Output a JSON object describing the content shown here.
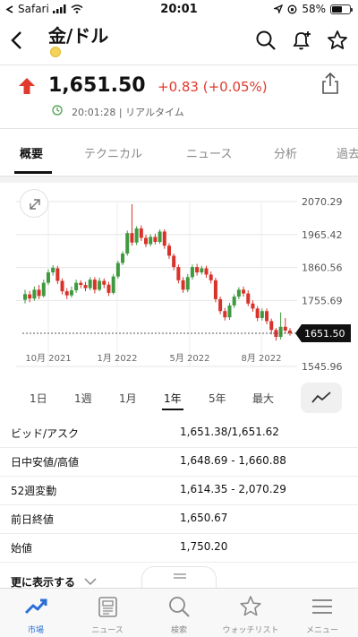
{
  "status_bar": {
    "carrier": "Safari",
    "time": "20:01",
    "battery": "58%",
    "battery_level": 0.58
  },
  "header": {
    "title": "金/ドル"
  },
  "quote": {
    "price": "1,651.50",
    "change": "+0.83 (+0.05%)",
    "time": "20:01:28 | リアルタイム",
    "up_color": "#e03a2e"
  },
  "tabs": [
    "概要",
    "テクニカル",
    "ニュース",
    "分析",
    "過去"
  ],
  "chart": {
    "current_label": "1,651.50"
  },
  "chart_data": {
    "type": "candlestick",
    "x_tick_labels": [
      "10月 2021",
      "1月 2022",
      "5月 2022",
      "8月 2022"
    ],
    "y_tick_labels": [
      "2070.29",
      "1965.42",
      "1860.56",
      "1755.69",
      "1545.96"
    ],
    "ylim": [
      1545.96,
      2070.29
    ],
    "current_value": 1651.5,
    "current_label": "1651.50",
    "grid": true,
    "candles": [
      {
        "o": 1758,
        "c": 1776,
        "h": 1790,
        "l": 1746
      },
      {
        "o": 1775,
        "c": 1762,
        "h": 1786,
        "l": 1750
      },
      {
        "o": 1762,
        "c": 1790,
        "h": 1800,
        "l": 1755
      },
      {
        "o": 1790,
        "c": 1770,
        "h": 1805,
        "l": 1760
      },
      {
        "o": 1770,
        "c": 1812,
        "h": 1822,
        "l": 1765
      },
      {
        "o": 1812,
        "c": 1845,
        "h": 1855,
        "l": 1805
      },
      {
        "o": 1845,
        "c": 1860,
        "h": 1868,
        "l": 1835
      },
      {
        "o": 1858,
        "c": 1818,
        "h": 1866,
        "l": 1808
      },
      {
        "o": 1818,
        "c": 1785,
        "h": 1826,
        "l": 1775
      },
      {
        "o": 1785,
        "c": 1772,
        "h": 1795,
        "l": 1760
      },
      {
        "o": 1772,
        "c": 1788,
        "h": 1800,
        "l": 1765
      },
      {
        "o": 1788,
        "c": 1812,
        "h": 1822,
        "l": 1780
      },
      {
        "o": 1812,
        "c": 1805,
        "h": 1820,
        "l": 1795
      },
      {
        "o": 1805,
        "c": 1795,
        "h": 1815,
        "l": 1785
      },
      {
        "o": 1795,
        "c": 1822,
        "h": 1830,
        "l": 1788
      },
      {
        "o": 1822,
        "c": 1790,
        "h": 1830,
        "l": 1778
      },
      {
        "o": 1790,
        "c": 1818,
        "h": 1828,
        "l": 1785
      },
      {
        "o": 1818,
        "c": 1806,
        "h": 1826,
        "l": 1795
      },
      {
        "o": 1806,
        "c": 1780,
        "h": 1815,
        "l": 1770
      },
      {
        "o": 1780,
        "c": 1832,
        "h": 1840,
        "l": 1775
      },
      {
        "o": 1832,
        "c": 1875,
        "h": 1882,
        "l": 1825
      },
      {
        "o": 1875,
        "c": 1905,
        "h": 1912,
        "l": 1868
      },
      {
        "o": 1905,
        "c": 1970,
        "h": 1978,
        "l": 1898
      },
      {
        "o": 1970,
        "c": 1940,
        "h": 2062,
        "l": 1930
      },
      {
        "o": 1940,
        "c": 1985,
        "h": 1992,
        "l": 1932
      },
      {
        "o": 1985,
        "c": 1955,
        "h": 1995,
        "l": 1945
      },
      {
        "o": 1955,
        "c": 1935,
        "h": 1965,
        "l": 1925
      },
      {
        "o": 1935,
        "c": 1958,
        "h": 1966,
        "l": 1928
      },
      {
        "o": 1958,
        "c": 1942,
        "h": 1968,
        "l": 1934
      },
      {
        "o": 1942,
        "c": 1975,
        "h": 1982,
        "l": 1936
      },
      {
        "o": 1975,
        "c": 1930,
        "h": 1982,
        "l": 1920
      },
      {
        "o": 1930,
        "c": 1898,
        "h": 1938,
        "l": 1888
      },
      {
        "o": 1898,
        "c": 1862,
        "h": 1905,
        "l": 1852
      },
      {
        "o": 1862,
        "c": 1820,
        "h": 1870,
        "l": 1810
      },
      {
        "o": 1820,
        "c": 1790,
        "h": 1830,
        "l": 1780
      },
      {
        "o": 1790,
        "c": 1830,
        "h": 1840,
        "l": 1782
      },
      {
        "o": 1830,
        "c": 1862,
        "h": 1870,
        "l": 1822
      },
      {
        "o": 1862,
        "c": 1845,
        "h": 1872,
        "l": 1835
      },
      {
        "o": 1845,
        "c": 1858,
        "h": 1866,
        "l": 1838
      },
      {
        "o": 1858,
        "c": 1838,
        "h": 1866,
        "l": 1828
      },
      {
        "o": 1838,
        "c": 1820,
        "h": 1848,
        "l": 1810
      },
      {
        "o": 1820,
        "c": 1760,
        "h": 1828,
        "l": 1750
      },
      {
        "o": 1760,
        "c": 1722,
        "h": 1768,
        "l": 1712
      },
      {
        "o": 1722,
        "c": 1702,
        "h": 1732,
        "l": 1692
      },
      {
        "o": 1702,
        "c": 1740,
        "h": 1748,
        "l": 1694
      },
      {
        "o": 1740,
        "c": 1768,
        "h": 1776,
        "l": 1732
      },
      {
        "o": 1768,
        "c": 1790,
        "h": 1798,
        "l": 1760
      },
      {
        "o": 1790,
        "c": 1778,
        "h": 1800,
        "l": 1768
      },
      {
        "o": 1778,
        "c": 1746,
        "h": 1788,
        "l": 1738
      },
      {
        "o": 1746,
        "c": 1730,
        "h": 1756,
        "l": 1720
      },
      {
        "o": 1730,
        "c": 1700,
        "h": 1738,
        "l": 1690
      },
      {
        "o": 1700,
        "c": 1722,
        "h": 1730,
        "l": 1692
      },
      {
        "o": 1722,
        "c": 1690,
        "h": 1730,
        "l": 1680
      },
      {
        "o": 1690,
        "c": 1662,
        "h": 1698,
        "l": 1648
      },
      {
        "o": 1662,
        "c": 1640,
        "h": 1668,
        "l": 1628
      },
      {
        "o": 1640,
        "c": 1672,
        "h": 1718,
        "l": 1632
      },
      {
        "o": 1672,
        "c": 1660,
        "h": 1700,
        "l": 1650
      },
      {
        "o": 1660,
        "c": 1651.5,
        "h": 1668,
        "l": 1644
      }
    ]
  },
  "periods": [
    "1日",
    "1週",
    "1月",
    "1年",
    "5年",
    "最大"
  ],
  "stats": [
    {
      "label": "ビッド/アスク",
      "value": "1,651.38/1,651.62"
    },
    {
      "label": "日中安値/高値",
      "value": "1,648.69 - 1,660.88"
    },
    {
      "label": "52週変動",
      "value": "1,614.35 - 2,070.29"
    },
    {
      "label": "前日終値",
      "value": "1,650.67"
    },
    {
      "label": "始値",
      "value": "1,750.20"
    }
  ],
  "more_label": "更に表示する",
  "nav": [
    {
      "label": "市場",
      "icon": "market-chart-icon"
    },
    {
      "label": "ニュース",
      "icon": "newspaper-icon"
    },
    {
      "label": "検索",
      "icon": "search-icon"
    },
    {
      "label": "ウォッチリスト",
      "icon": "star-icon"
    },
    {
      "label": "メニュー",
      "icon": "menu-icon"
    }
  ],
  "colors": {
    "bull": "#3f9a3f",
    "bear": "#d8332b",
    "accent": "#2a6fd6"
  }
}
